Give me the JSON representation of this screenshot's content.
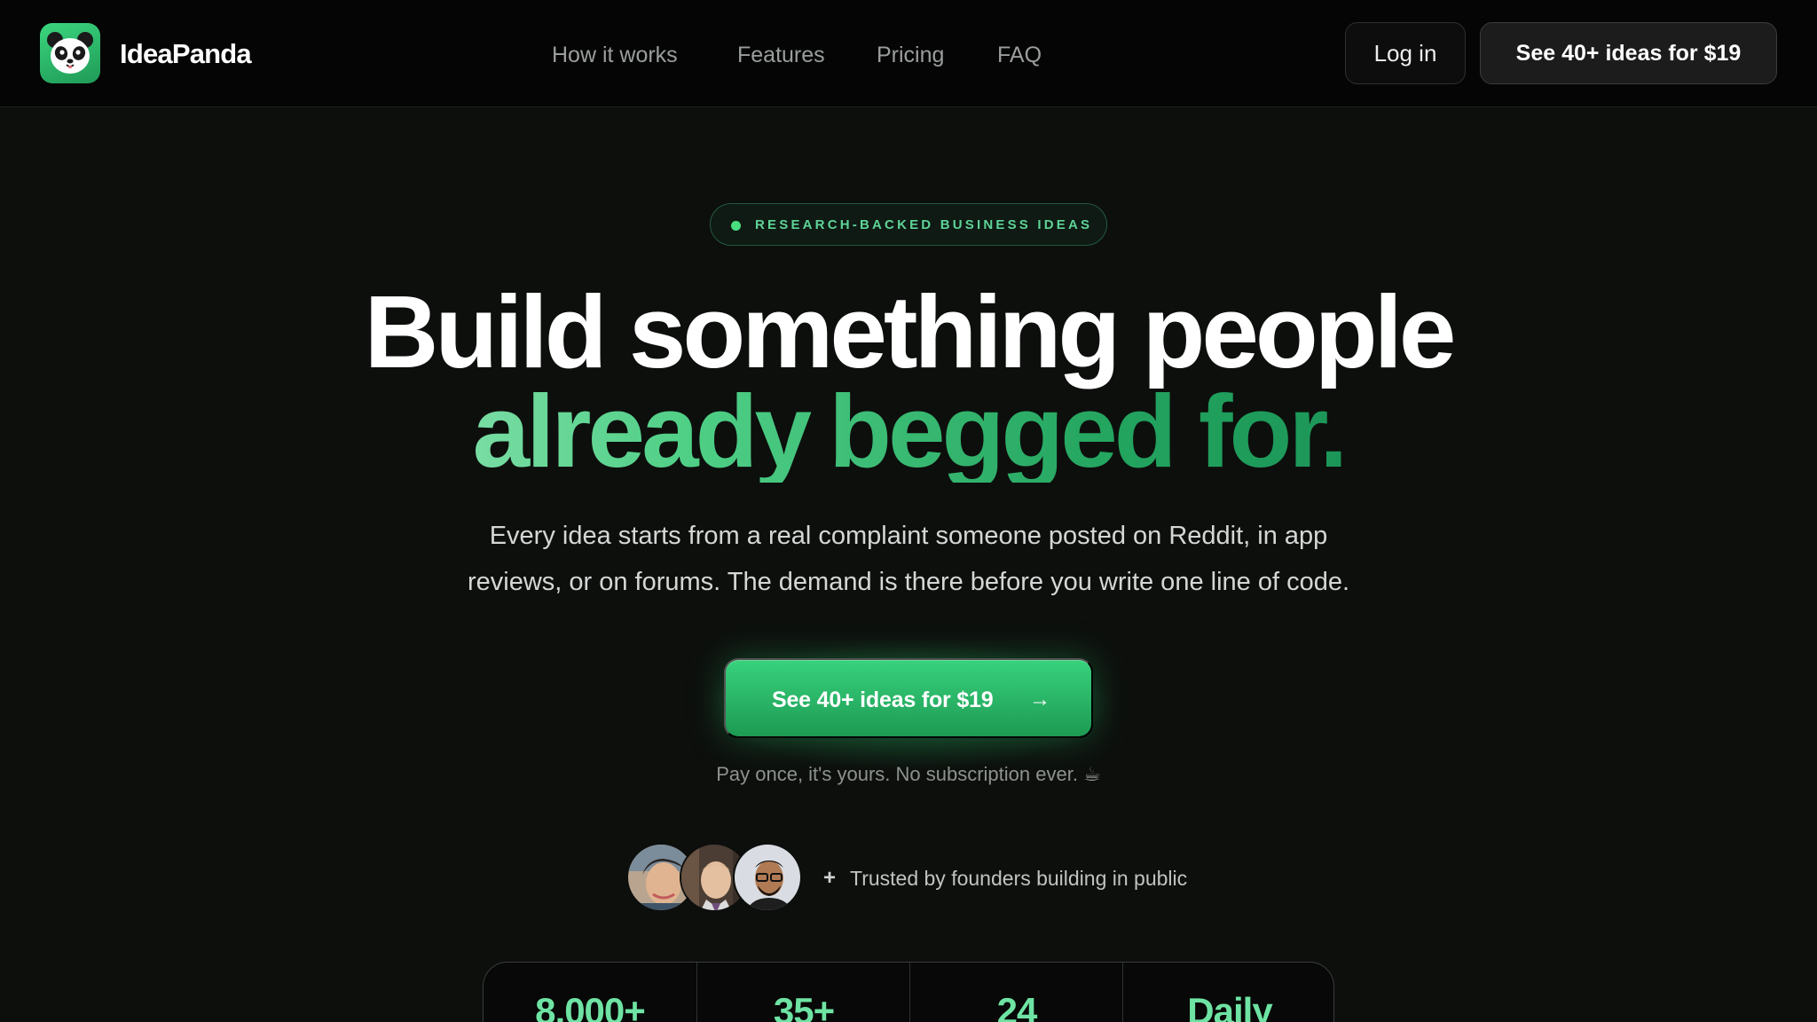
{
  "nav": {
    "logo_icon": "panda-logo-icon",
    "brand": "IdeaPanda",
    "links": [
      "How it works",
      "Features",
      "Pricing",
      "FAQ"
    ],
    "login_label": "Log in",
    "cta_label": "See 40+ ideas for $19"
  },
  "hero": {
    "badge": "RESEARCH-BACKED BUSINESS IDEAS",
    "title_line1": "Build something people",
    "title_line2_a": "already",
    "title_line2_b": "begged for.",
    "subtitle_line1": "Every idea starts from a real complaint someone posted on Reddit, in app",
    "subtitle_line2": "reviews, or on forums. The demand is there before you write one line of code.",
    "cta_label": "See 40+ ideas for $19",
    "cta_arrow": "→",
    "note": "Pay once, it's yours. No subscription ever. ☕",
    "trust_plus": "+",
    "trust_text": "Trusted by founders building in public"
  },
  "stats": [
    "8,000+",
    "35+",
    "24",
    "Daily"
  ],
  "colors": {
    "accent": "#2bbf6c",
    "accent_light": "#6ee3a3",
    "background": "#0d0f0d",
    "nav_background": "#050505"
  }
}
